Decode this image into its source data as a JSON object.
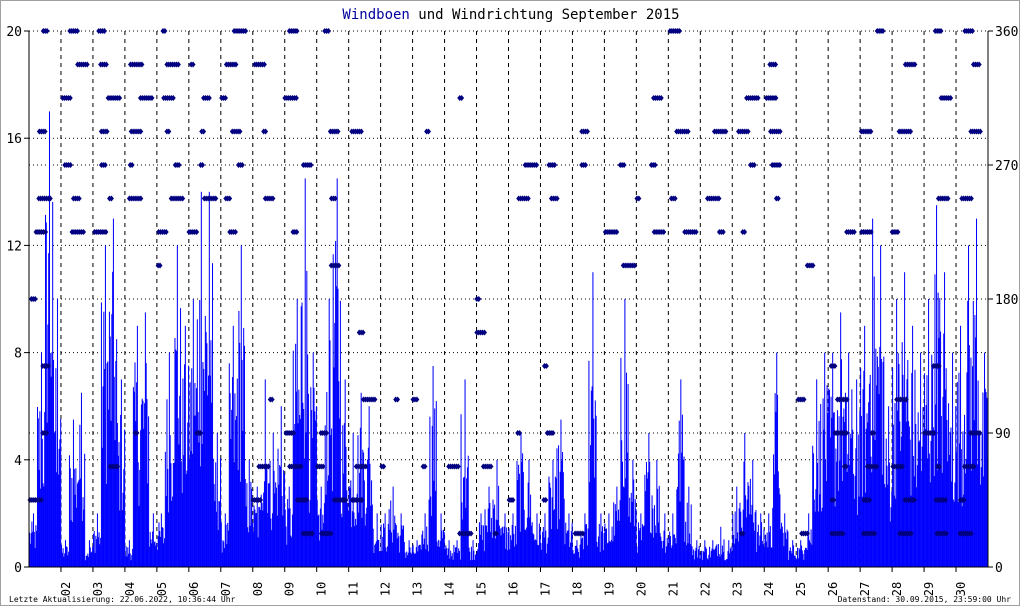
{
  "chart_data": {
    "type": "bar",
    "title_part1": "Windboen",
    "title_part2": " und Windrichtung September 2015",
    "colors": {
      "gust": "#0000ff",
      "direction": "#000080",
      "title_accent": "#0000a0"
    },
    "left_axis": {
      "label": "Windboen",
      "ylim": [
        0,
        20
      ],
      "ticks": [
        "0",
        "4",
        "8",
        "12",
        "16",
        "20"
      ]
    },
    "right_axis": {
      "label": "Windrichtung",
      "ylim": [
        0,
        360
      ],
      "ticks": [
        "0",
        "90",
        "180",
        "270",
        "360"
      ]
    },
    "x_ticks": [
      "02",
      "03",
      "04",
      "05",
      "06",
      "07",
      "08",
      "09",
      "10",
      "11",
      "12",
      "13",
      "14",
      "15",
      "16",
      "17",
      "18",
      "19",
      "20",
      "21",
      "22",
      "23",
      "24",
      "25",
      "26",
      "27",
      "28",
      "29",
      "30"
    ],
    "days": 30,
    "gust_peaks_per_quarter_day": [
      [
        2,
        8,
        17,
        10
      ],
      [
        1,
        5.5,
        6.5,
        1
      ],
      [
        2,
        12,
        13,
        7
      ],
      [
        1,
        9,
        9.5,
        2
      ],
      [
        2,
        8,
        12,
        9
      ],
      [
        10,
        14,
        14,
        5
      ],
      [
        2,
        9,
        12,
        4
      ],
      [
        3,
        7,
        5,
        6
      ],
      [
        3,
        10,
        14.5,
        8
      ],
      [
        3,
        10,
        14.5,
        7
      ],
      [
        5,
        6.5,
        6,
        2
      ],
      [
        2,
        3,
        2,
        1
      ],
      [
        1,
        2,
        7.5,
        2
      ],
      [
        1,
        1,
        7,
        1
      ],
      [
        2,
        3,
        4,
        2
      ],
      [
        2,
        5,
        4,
        2
      ],
      [
        2,
        4,
        5.5,
        2
      ],
      [
        1,
        2,
        11,
        2
      ],
      [
        2,
        3,
        10,
        4
      ],
      [
        2,
        5,
        4,
        2
      ],
      [
        2,
        7,
        3,
        1
      ],
      [
        1,
        1,
        1.5,
        1
      ],
      [
        3,
        5,
        4,
        2
      ],
      [
        2,
        8,
        2,
        1
      ],
      [
        1,
        2,
        7,
        8
      ],
      [
        8,
        9.5,
        8,
        7
      ],
      [
        9,
        13,
        12,
        6
      ],
      [
        10,
        11,
        9,
        8
      ],
      [
        10,
        13.5,
        11,
        8
      ],
      [
        9,
        12,
        13,
        8
      ]
    ],
    "directions_per_day": [
      [
        360,
        292.5,
        247.5,
        225,
        180,
        135,
        90,
        45
      ],
      [
        360,
        337.5,
        315,
        270,
        247.5,
        225
      ],
      [
        360,
        337.5,
        315,
        292.5,
        270,
        247.5,
        225,
        67.5
      ],
      [
        337.5,
        315,
        292.5,
        270,
        247.5,
        90
      ],
      [
        360,
        337.5,
        315,
        292.5,
        270,
        247.5,
        225,
        202.5
      ],
      [
        337.5,
        315,
        292.5,
        270,
        247.5,
        225,
        90
      ],
      [
        360,
        337.5,
        315,
        292.5,
        270,
        247.5,
        225
      ],
      [
        337.5,
        292.5,
        247.5,
        112.5,
        67.5,
        45
      ],
      [
        360,
        315,
        270,
        225,
        90,
        67.5,
        45,
        22.5
      ],
      [
        360,
        292.5,
        247.5,
        202.5,
        90,
        67.5,
        45,
        22.5
      ],
      [
        292.5,
        157.5,
        112.5,
        67.5,
        45
      ],
      [
        67.5,
        112.5
      ],
      [
        67.5,
        112.5,
        292.5
      ],
      [
        67.5,
        22.5,
        315
      ],
      [
        180,
        157.5,
        67.5,
        22.5
      ],
      [
        90,
        45,
        270,
        247.5
      ],
      [
        270,
        247.5,
        45,
        90,
        135
      ],
      [
        292.5,
        270,
        22.5
      ],
      [
        225,
        202.5,
        270
      ],
      [
        270,
        247.5,
        225,
        315
      ],
      [
        292.5,
        247.5,
        225,
        360
      ],
      [
        247.5,
        225,
        292.5
      ],
      [
        315,
        292.5,
        270,
        225,
        22.5
      ],
      [
        337.5,
        315,
        292.5,
        270,
        247.5
      ],
      [
        202.5,
        112.5,
        22.5
      ],
      [
        225,
        135,
        112.5,
        90,
        67.5,
        45,
        22.5
      ],
      [
        360,
        292.5,
        225,
        90,
        67.5,
        45,
        22.5
      ],
      [
        337.5,
        292.5,
        225,
        112.5,
        67.5,
        45,
        22.5
      ],
      [
        360,
        315,
        247.5,
        135,
        90,
        67.5,
        45,
        22.5
      ],
      [
        360,
        337.5,
        292.5,
        247.5,
        90,
        67.5,
        45,
        22.5
      ]
    ]
  },
  "footer": {
    "left": "Letzte Aktualisierung: 22.06.2022, 10:36:44 Uhr",
    "right": "Datenstand: 30.09.2015, 23:59:00 Uhr"
  }
}
